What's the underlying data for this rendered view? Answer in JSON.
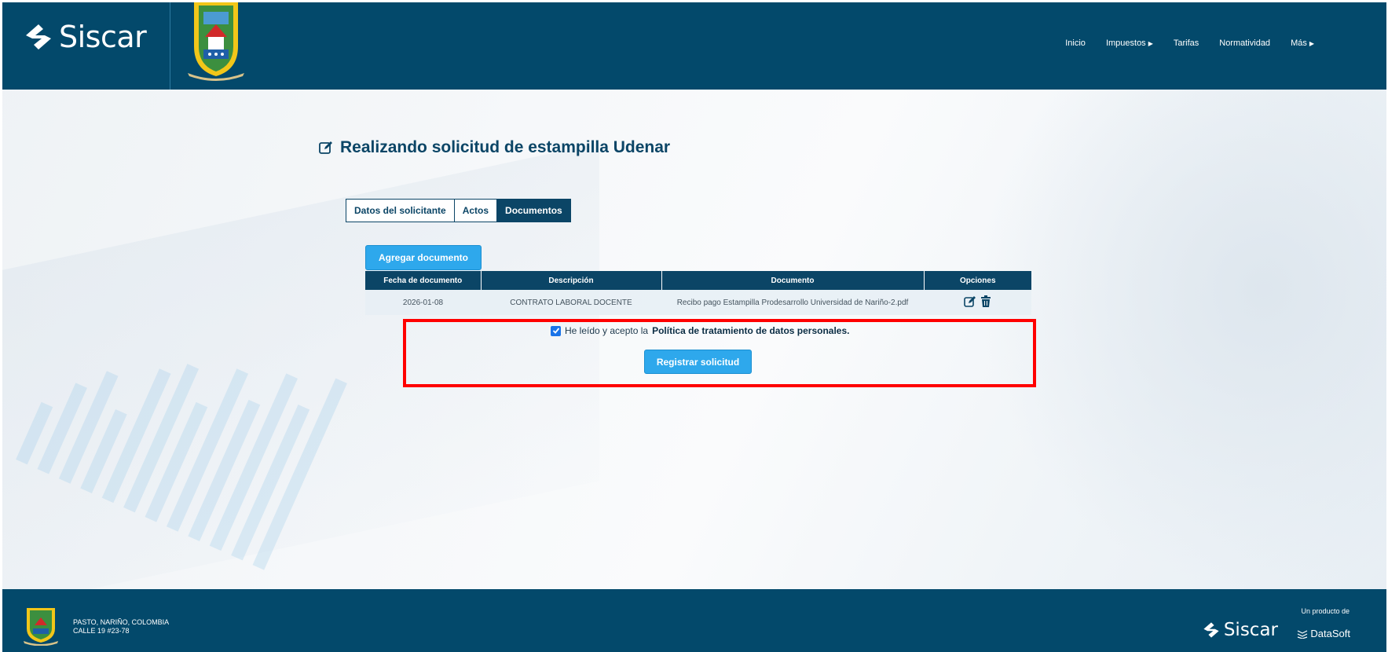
{
  "header": {
    "brand": "Siscar",
    "nav": [
      {
        "label": "Inicio",
        "has_caret": false
      },
      {
        "label": "Impuestos",
        "has_caret": true
      },
      {
        "label": "Tarifas",
        "has_caret": false
      },
      {
        "label": "Normatividad",
        "has_caret": false
      },
      {
        "label": "Más",
        "has_caret": true
      }
    ]
  },
  "page": {
    "title": "Realizando solicitud de estampilla Udenar",
    "tabs": [
      {
        "label": "Datos del solicitante",
        "active": false
      },
      {
        "label": "Actos",
        "active": false
      },
      {
        "label": "Documentos",
        "active": true
      }
    ],
    "add_button": "Agregar documento"
  },
  "table": {
    "columns": [
      "Fecha de documento",
      "Descripción",
      "Documento",
      "Opciones"
    ],
    "rows": [
      {
        "fecha": "2026-01-08",
        "descripcion": "CONTRATO LABORAL DOCENTE",
        "documento": "Recibo pago Estampilla Prodesarrollo Universidad de Nariño-2.pdf",
        "options": [
          "edit-icon",
          "trash-icon"
        ]
      }
    ]
  },
  "consent": {
    "checked": true,
    "text": "He leído y acepto la",
    "policy": "Política de tratamiento de datos personales.",
    "submit": "Registrar solicitud"
  },
  "footer": {
    "address_line1": "PASTO, NARIÑO, COLOMBIA",
    "address_line2": "CALLE 19 #23-78",
    "brand": "Siscar",
    "product_of": "Un producto de",
    "company": "DataSoft"
  },
  "colors": {
    "primary": "#03496b",
    "accent": "#2ea8ec",
    "highlight": "#ff0000"
  }
}
